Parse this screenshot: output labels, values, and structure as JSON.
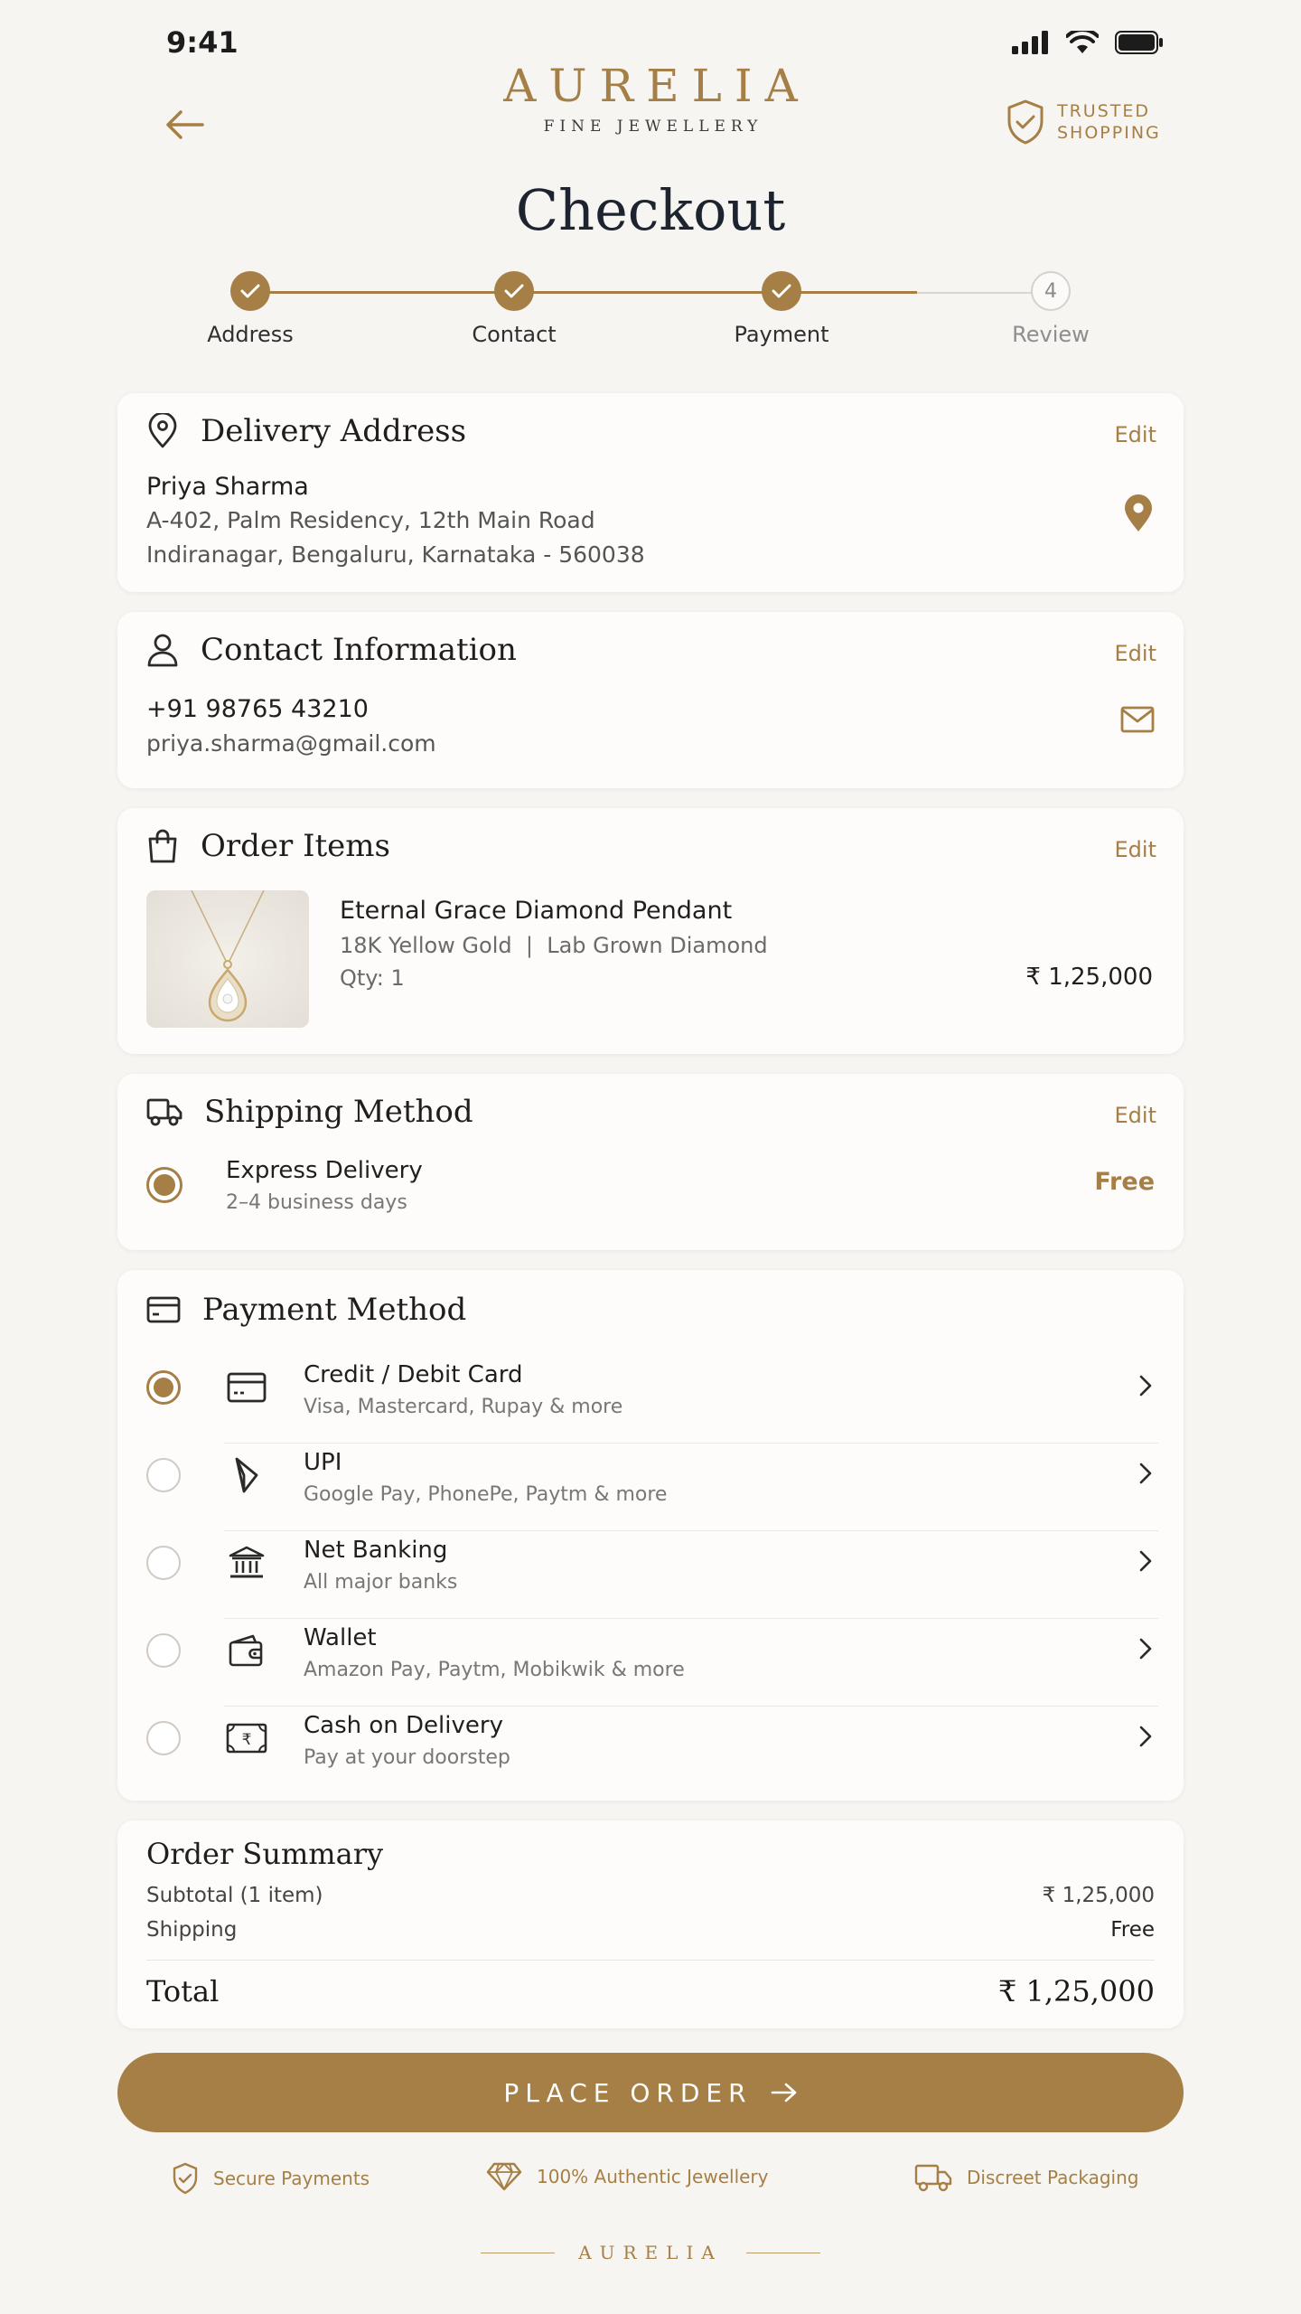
{
  "status_bar": {
    "time": "9:41"
  },
  "header": {
    "brand_name": "AURELIA",
    "brand_sub": "FINE JEWELLERY",
    "trusted_line1": "TRUSTED",
    "trusted_line2": "SHOPPING"
  },
  "page_title": "Checkout",
  "steps": [
    {
      "label": "Address",
      "state": "done"
    },
    {
      "label": "Contact",
      "state": "done"
    },
    {
      "label": "Payment",
      "state": "done"
    },
    {
      "label": "Review",
      "state": "todo",
      "number": "4"
    }
  ],
  "delivery": {
    "title": "Delivery Address",
    "edit": "Edit",
    "name": "Priya Sharma",
    "line1": "A-402, Palm Residency, 12th Main Road",
    "line2": "Indiranagar, Bengaluru, Karnataka - 560038"
  },
  "contact": {
    "title": "Contact Information",
    "edit": "Edit",
    "phone": "+91 98765 43210",
    "email": "priya.sharma@gmail.com"
  },
  "order_items": {
    "title": "Order Items",
    "edit": "Edit",
    "item_name": "Eternal Grace Diamond Pendant",
    "item_spec": "18K Yellow Gold  |  Lab Grown Diamond",
    "item_qty": "Qty: 1",
    "item_price": "₹ 1,25,000"
  },
  "shipping": {
    "title": "Shipping Method",
    "edit": "Edit",
    "option_title": "Express Delivery",
    "option_sub": "2–4 business days",
    "option_price": "Free"
  },
  "payment": {
    "title": "Payment Method",
    "options": [
      {
        "title": "Credit / Debit Card",
        "sub": "Visa, Mastercard, Rupay & more",
        "selected": true
      },
      {
        "title": "UPI",
        "sub": "Google Pay, PhonePe, Paytm & more",
        "selected": false
      },
      {
        "title": "Net Banking",
        "sub": "All major banks",
        "selected": false
      },
      {
        "title": "Wallet",
        "sub": "Amazon Pay, Paytm, Mobikwik & more",
        "selected": false
      },
      {
        "title": "Cash on Delivery",
        "sub": "Pay at your doorstep",
        "selected": false
      }
    ]
  },
  "summary": {
    "title": "Order Summary",
    "subtotal_label": "Subtotal (1 item)",
    "subtotal_value": "₹ 1,25,000",
    "shipping_label": "Shipping",
    "shipping_value": "Free",
    "total_label": "Total",
    "total_value": "₹ 1,25,000"
  },
  "cta": {
    "label": "PLACE ORDER"
  },
  "trust": {
    "secure": "Secure Payments",
    "authentic": "100% Authentic Jewellery",
    "packaging": "Discreet Packaging"
  },
  "footer": {
    "brand": "AURELIA"
  },
  "colors": {
    "accent": "#a57f45",
    "background": "#f7f5f1",
    "card": "#fdfcfa"
  }
}
